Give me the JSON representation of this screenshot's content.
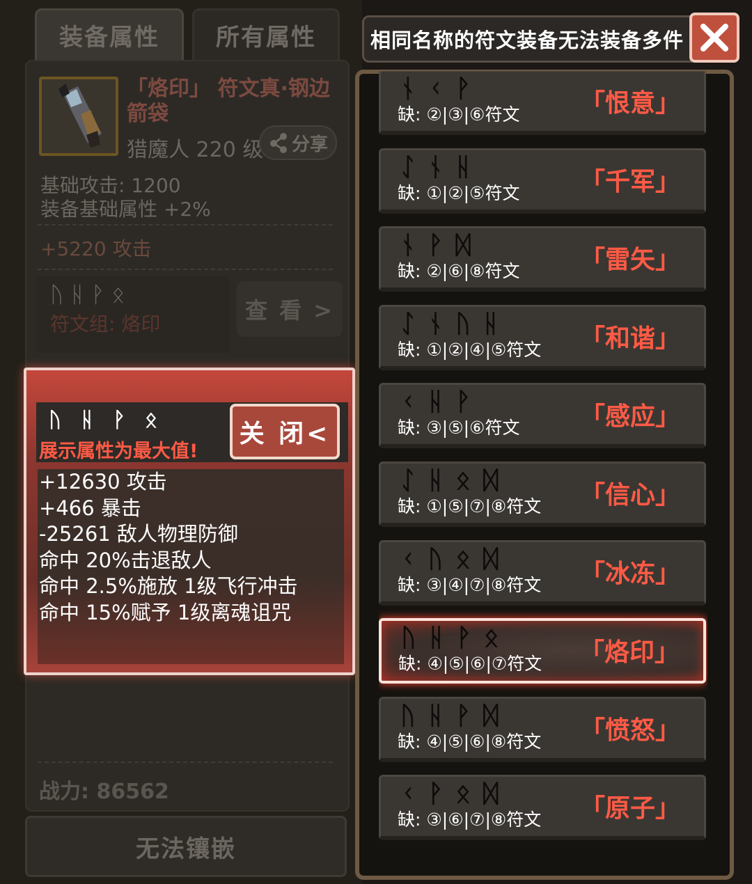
{
  "tabs": [
    {
      "label": "装备属性"
    },
    {
      "label": "所有属性"
    }
  ],
  "item": {
    "icon": "quiver-icon",
    "name": "「烙印」 符文真·钢边箭袋",
    "class_level": "猎魔人 220 级",
    "share_label": "分享",
    "base_attack": "基础攻击:  1200",
    "base_bonus": "装备基础属性 +2%",
    "bonus_attack": "+5220 攻击",
    "runes": "ᚢ ᚺ ᚹ ᛟ",
    "set_label": "符文组:  烙印",
    "view_label": "查 看 >",
    "power": "战力:  86562",
    "inlay_button": "无法镶嵌"
  },
  "popup": {
    "runes": [
      "ᚢ",
      "ᚺ",
      "ᚹ",
      "ᛟ"
    ],
    "note": "展示属性为最大值!",
    "close_label": "关 闭<",
    "stats": [
      "+12630 攻击",
      "+466 暴击",
      "-25261 敌人物理防御",
      "命中 20%击退敌人",
      "命中 2.5%施放 1级飞行冲击",
      "命中 15%赋予 1级离魂诅咒"
    ]
  },
  "banner": {
    "text": "相同名称的符文装备无法装备多件",
    "close_icon": "close-icon"
  },
  "rune_sets": [
    {
      "runes": [
        "ᚾ",
        "ᚲ",
        "ᚹ"
      ],
      "missing": "缺:  ②|③|⑥符文",
      "name": "「恨意」",
      "selected": false
    },
    {
      "runes": [
        "ᛇ",
        "ᚾ",
        "ᚺ"
      ],
      "missing": "缺:  ①|②|⑤符文",
      "name": "「千军」",
      "selected": false
    },
    {
      "runes": [
        "ᚾ",
        "ᚹ",
        "ᛞ"
      ],
      "missing": "缺:  ②|⑥|⑧符文",
      "name": "「雷矢」",
      "selected": false
    },
    {
      "runes": [
        "ᛇ",
        "ᚾ",
        "ᚢ",
        "ᚺ"
      ],
      "missing": "缺:  ①|②|④|⑤符文",
      "name": "「和谐」",
      "selected": false
    },
    {
      "runes": [
        "ᚲ",
        "ᚺ",
        "ᚹ"
      ],
      "missing": "缺:  ③|⑤|⑥符文",
      "name": "「感应」",
      "selected": false
    },
    {
      "runes": [
        "ᛇ",
        "ᚺ",
        "ᛟ",
        "ᛞ"
      ],
      "missing": "缺:  ①|⑤|⑦|⑧符文",
      "name": "「信心」",
      "selected": false
    },
    {
      "runes": [
        "ᚲ",
        "ᚢ",
        "ᛟ",
        "ᛞ"
      ],
      "missing": "缺:  ③|④|⑦|⑧符文",
      "name": "「冰冻」",
      "selected": false
    },
    {
      "runes": [
        "ᚢ",
        "ᚺ",
        "ᚹ",
        "ᛟ"
      ],
      "missing": "缺:  ④|⑤|⑥|⑦符文",
      "name": "「烙印」",
      "selected": true
    },
    {
      "runes": [
        "ᚢ",
        "ᚺ",
        "ᚹ",
        "ᛞ"
      ],
      "missing": "缺:  ④|⑤|⑥|⑧符文",
      "name": "「愤怒」",
      "selected": false
    },
    {
      "runes": [
        "ᚲ",
        "ᚹ",
        "ᛟ",
        "ᛞ"
      ],
      "missing": "缺:  ③|⑥|⑦|⑧符文",
      "name": "「原子」",
      "selected": false
    }
  ],
  "colors": {
    "accent_red": "#ff5a45",
    "popup_border": "#f0d2cc",
    "frame_brown": "#6e5a43"
  }
}
